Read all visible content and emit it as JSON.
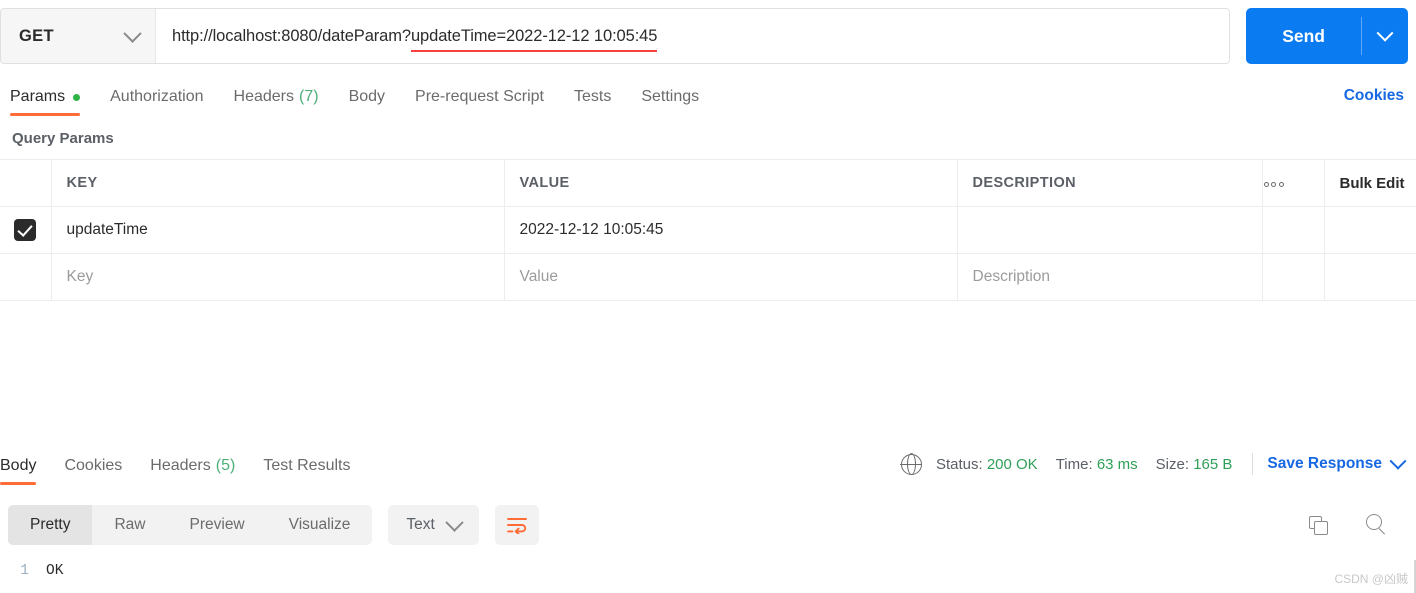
{
  "request": {
    "method": "GET",
    "method_caret": "chevron-down",
    "url_prefix": "http://localhost:8080/dateParam?",
    "url_underlined": "updateTime=2022-12-12 10:05:45",
    "url_full": "http://localhost:8080/dateParam?updateTime=2022-12-12 10:05:45",
    "underline_color": "#f6413d",
    "send_label": "Send",
    "send_color": "#0b7bf2",
    "tabs": [
      {
        "label": "Params",
        "active": true,
        "dot": true
      },
      {
        "label": "Authorization",
        "active": false
      },
      {
        "label": "Headers",
        "count": "(7)",
        "active": false
      },
      {
        "label": "Body",
        "active": false
      },
      {
        "label": "Pre-request Script",
        "active": false
      },
      {
        "label": "Tests",
        "active": false
      },
      {
        "label": "Settings",
        "active": false
      }
    ],
    "cookies_link": "Cookies",
    "active_tab_underline_color": "#ff6c37"
  },
  "query_params": {
    "title": "Query Params",
    "columns": [
      "KEY",
      "VALUE",
      "DESCRIPTION"
    ],
    "options_icon": "ooo",
    "bulk_edit_label": "Bulk Edit",
    "rows": [
      {
        "checked": true,
        "key": "updateTime",
        "value": "2022-12-12 10:05:45",
        "description": ""
      }
    ],
    "placeholder_row": {
      "key": "Key",
      "value": "Value",
      "description": "Description"
    }
  },
  "response": {
    "tabs": [
      {
        "label": "Body",
        "active": true
      },
      {
        "label": "Cookies",
        "active": false
      },
      {
        "label": "Headers",
        "count": "(5)",
        "active": false
      },
      {
        "label": "Test Results",
        "active": false
      }
    ],
    "status_label": "Status:",
    "status_value": "200 OK",
    "time_label": "Time:",
    "time_value": "63 ms",
    "size_label": "Size:",
    "size_value": "165 B",
    "status_value_color": "#2f9e56",
    "save_response_label": "Save Response",
    "format_tabs": [
      {
        "label": "Pretty",
        "active": true
      },
      {
        "label": "Raw",
        "active": false
      },
      {
        "label": "Preview",
        "active": false
      },
      {
        "label": "Visualize",
        "active": false
      }
    ],
    "content_type": "Text",
    "wrap_icon": "word-wrap",
    "wrap_icon_color": "#ff6c37",
    "body_lines": [
      {
        "number": "1",
        "text": "OK"
      }
    ]
  },
  "watermark": "CSDN @凶贼"
}
